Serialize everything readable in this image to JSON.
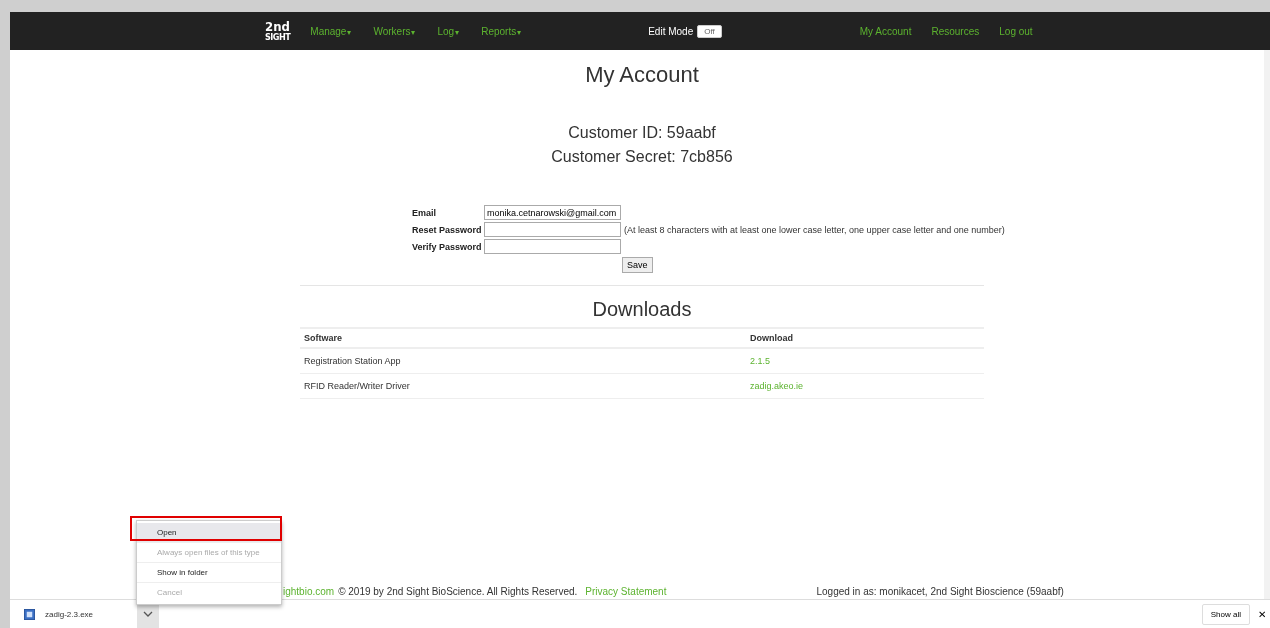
{
  "navbar": {
    "logo": {
      "top": "2nd",
      "bottom": "SIGHT"
    },
    "menus": [
      {
        "label": "Manage",
        "caret": "▾"
      },
      {
        "label": "Workers",
        "caret": "▾"
      },
      {
        "label": "Log",
        "caret": "▾"
      },
      {
        "label": "Reports",
        "caret": "▾"
      }
    ],
    "edit_mode": {
      "label": "Edit Mode",
      "toggle": "Off",
      "on": false
    },
    "links": [
      "My Account",
      "Resources",
      "Log out"
    ]
  },
  "title": "My Account",
  "customer": [
    "Customer ID: 59aabf",
    "Customer Secret: 7cb856"
  ],
  "form": {
    "fields": [
      {
        "label": "Email",
        "value": "monika.cetnarowski@gmail.com"
      },
      {
        "label": "Reset Password",
        "hint": "(At least 8 characters with at least one lower case letter, one upper case letter and one number)"
      },
      {
        "label": "Verify Password"
      }
    ],
    "save": "Save"
  },
  "downloads": {
    "title": "Downloads",
    "columns": [
      "Software",
      "Download"
    ],
    "rows": [
      {
        "software": "Registration Station App",
        "download": "2.1.5"
      },
      {
        "software": "RFID Reader/Writer Driver",
        "download": "zadig.akeo.ie"
      }
    ]
  },
  "footer": {
    "link": "ightbio.com",
    "copyright": "© 2019 by 2nd Sight BioScience. All Rights Reserved.",
    "privacy": "Privacy Statement",
    "logged_in": "Logged in as: monikacet, 2nd Sight Bioscience (59aabf)"
  },
  "context_menu": [
    {
      "label": "Open",
      "selected": true,
      "disabled": false
    },
    {
      "label": "Always open files of this type",
      "selected": false,
      "disabled": true
    },
    {
      "label": "Show in folder",
      "selected": false,
      "disabled": false
    },
    {
      "label": "Cancel",
      "selected": false,
      "disabled": true
    }
  ],
  "download_bar": {
    "file": "zadig-2.3.exe",
    "show_all": "Show all",
    "close": "✕"
  }
}
